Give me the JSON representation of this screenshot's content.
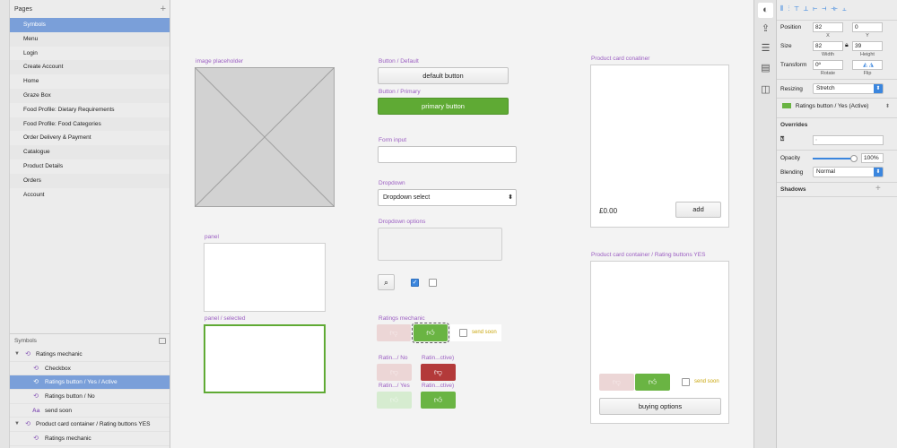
{
  "pages": {
    "header": "Pages",
    "add": "+",
    "items": [
      "Symbols",
      "Menu",
      "Login",
      "Create Account",
      "Home",
      "Graze Box",
      "Food Profile: Dietary Requirements",
      "Food Profile: Food Categories",
      "Order Delivery & Payment",
      "Catalogue",
      "Product Details",
      "Orders",
      "Account"
    ]
  },
  "symbols": {
    "header": "Symbols",
    "items": [
      {
        "label": "Ratings mechanic",
        "level": 0,
        "icon": "symbol-icon"
      },
      {
        "label": "Checkbox",
        "level": 1,
        "icon": "symbol-icon"
      },
      {
        "label": "Ratings button / Yes / Active",
        "level": 1,
        "icon": "symbol-icon"
      },
      {
        "label": "Ratings button / No",
        "level": 1,
        "icon": "symbol-icon"
      },
      {
        "label": "send soon",
        "level": 1,
        "icon": "text-icon"
      },
      {
        "label": "Product card container / Rating buttons YES",
        "level": 0,
        "icon": "symbol-icon"
      },
      {
        "label": "Ratings mechanic",
        "level": 1,
        "icon": "symbol-icon"
      }
    ]
  },
  "canvas": {
    "image_placeholder": "image placeholder",
    "button_default_label": "Button / Default",
    "button_default_text": "default button",
    "button_primary_label": "Button / Primary",
    "button_primary_text": "primary button",
    "form_input_label": "Form input",
    "dropdown_label": "Dropdown",
    "dropdown_value": "Dropdown select",
    "dropdown_options_label": "Dropdown options",
    "panel_label": "panel",
    "panel_selected_label": "panel / selected",
    "ratings_mechanic_label": "Ratings mechanic",
    "send_soon": "send soon",
    "rating_no_label": "Ratin.../ No",
    "rating_no_active_label": "Ratin...ctive)",
    "rating_yes_label": "Ratin.../ Yes",
    "rating_yes_active_label": "Ratin...ctive)",
    "card_label": "Product card conatiner",
    "card_price": "£0.00",
    "card_add": "add",
    "card2_label": "Product card container / Rating buttons YES",
    "card2_send_soon": "send soon",
    "card2_button": "buying options"
  },
  "inspector": {
    "position_label": "Position",
    "x": "82",
    "y": "0",
    "x_sub": "X",
    "y_sub": "Y",
    "size_label": "Size",
    "width": "82",
    "height": "39",
    "width_sub": "Width",
    "height_sub": "Height",
    "transform_label": "Transform",
    "rotate": "0º",
    "rotate_sub": "Rotate",
    "flip_sub": "Flip",
    "resizing_label": "Resizing",
    "resizing_value": "Stretch",
    "symbol_value": "Ratings button / Yes (Active)",
    "overrides_label": "Overrides",
    "opacity_label": "Opacity",
    "opacity_value": "100%",
    "opacity_level": 1.0,
    "blending_label": "Blending",
    "blending_value": "Normal",
    "shadows_label": "Shadows",
    "shadows_add": "+"
  },
  "colors": {
    "accent": "#7a9fd9",
    "primary_green": "#5faa34",
    "label_purple": "#9b5ec2",
    "no_red": "#b33a3a"
  }
}
